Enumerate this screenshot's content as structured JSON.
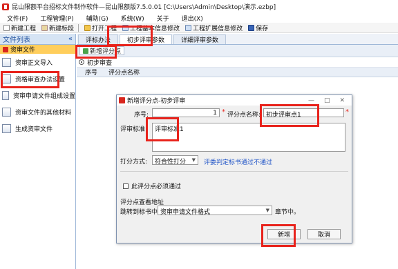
{
  "window": {
    "title": "昆山限额平台招标文件制作软件—昆山限额版7.5.0.01    [C:\\Users\\Admin\\Desktop\\演示.ezbp]"
  },
  "menu": [
    "文件(F)",
    "工程管理(P)",
    "辅助(G)",
    "系统(W)",
    "关于",
    "退出(X)"
  ],
  "toolbar": {
    "new_project": "新建工程",
    "new_segment": "新建标段",
    "open_project": "打开工程",
    "basic_info": "工程基本信息修改",
    "ext_info": "工程扩展信息修改",
    "save": "保存"
  },
  "sidebar": {
    "title": "文件列表",
    "collapse": "«",
    "selected": "资审文件",
    "items": [
      {
        "label": "资审正文导入"
      },
      {
        "label": "资格审查办法设置"
      },
      {
        "label": "资审申请文件组成设置"
      },
      {
        "label": "资审文件的其他材料"
      },
      {
        "label": "生成资审文件"
      }
    ]
  },
  "tabs": [
    "评标办法",
    "初步评审参数",
    "详细评审参数"
  ],
  "add_button": "新增评分点",
  "radio_label": "初步审查",
  "grid_headers": [
    "序号",
    "评分点名称"
  ],
  "dialog": {
    "title": "新增评分点-初步评审",
    "seq_label": "序号:",
    "seq_value": "1",
    "name_label": "评分点名称:",
    "name_value": "初步评审点1",
    "std_label": "评审标准:",
    "std_value": "评审标准1",
    "method_label": "打分方式:",
    "method_value": "符合性打分",
    "method_hint": "评委判定标书通过不通过",
    "must_pass": "此评分点必须通过",
    "addr_section": "评分点查看地址",
    "jump_label": "跳转到标书中",
    "jump_value": "资审申请文件格式",
    "chapter_suffix": "章节中。",
    "add_button": "新增",
    "cancel_button": "取消",
    "required_mark": "*"
  }
}
